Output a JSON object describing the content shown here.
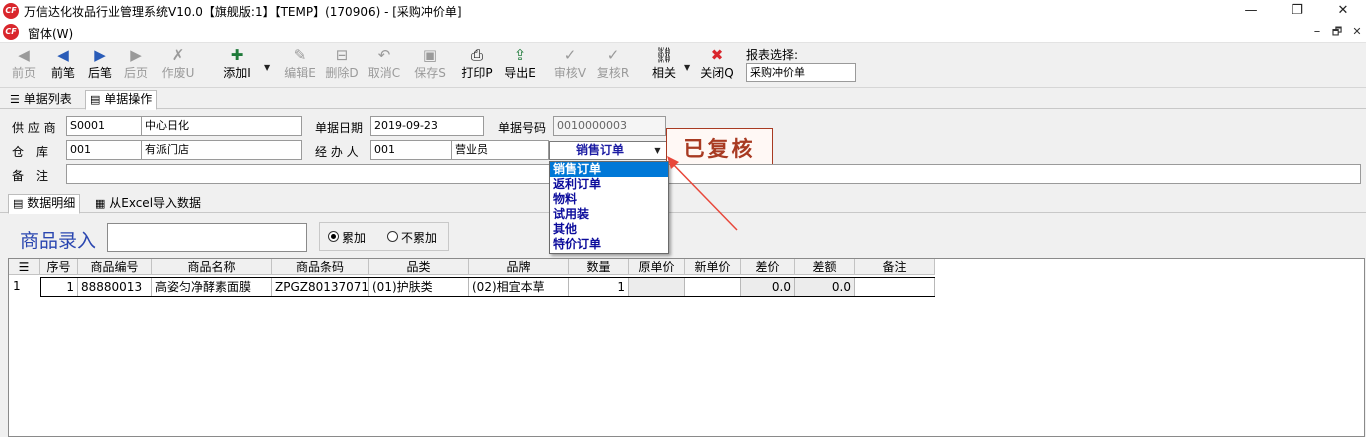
{
  "window": {
    "title": "万信达化妆品行业管理系统V10.0【旗舰版:1】【TEMP】(170906) - [采购冲价单]",
    "menu_label": "窗体(W)",
    "logo_text": "CF",
    "controls": {
      "minimize": "—",
      "maximize": "❐",
      "close": "✕"
    }
  },
  "toolbar": {
    "buttons": [
      {
        "label": "前页",
        "icon": "first-page-icon",
        "glyph": "◀",
        "enabled": false
      },
      {
        "label": "前笔",
        "icon": "prev-record-icon",
        "glyph": "◀",
        "enabled": true
      },
      {
        "label": "后笔",
        "icon": "next-record-icon",
        "glyph": "▶",
        "enabled": true
      },
      {
        "label": "后页",
        "icon": "last-page-icon",
        "glyph": "▶",
        "enabled": false
      },
      {
        "label": "作废U",
        "icon": "void-icon",
        "glyph": "✗",
        "enabled": false
      },
      {
        "label": "添加I",
        "icon": "add-icon",
        "glyph": "✚",
        "enabled": true
      },
      {
        "label": "编辑E",
        "icon": "edit-icon",
        "glyph": "✎",
        "enabled": false
      },
      {
        "label": "删除D",
        "icon": "delete-icon",
        "glyph": "⊟",
        "enabled": false
      },
      {
        "label": "取消C",
        "icon": "undo-icon",
        "glyph": "↶",
        "enabled": false
      },
      {
        "label": "保存S",
        "icon": "save-icon",
        "glyph": "▣",
        "enabled": false
      },
      {
        "label": "打印P",
        "icon": "print-icon",
        "glyph": "⎙",
        "enabled": true
      },
      {
        "label": "导出E",
        "icon": "export-icon",
        "glyph": "⇪",
        "enabled": true
      },
      {
        "label": "审核V",
        "icon": "approve-icon",
        "glyph": "✓",
        "enabled": false
      },
      {
        "label": "复核R",
        "icon": "review-icon",
        "glyph": "✓",
        "enabled": false
      },
      {
        "label": "相关",
        "icon": "link-icon",
        "glyph": "⛓",
        "enabled": true
      },
      {
        "label": "关闭Q",
        "icon": "close-icon",
        "glyph": "✖",
        "enabled": true
      }
    ],
    "report_select_label": "报表选择:",
    "report_select_value": "采购冲价单"
  },
  "tabs_top": [
    {
      "label": "单据列表",
      "icon": "list-icon"
    },
    {
      "label": "单据操作",
      "icon": "document-icon"
    }
  ],
  "form": {
    "supplier_label": "供 应 商",
    "supplier_code": "S0001",
    "supplier_name": "中心日化",
    "doc_date_label": "单据日期",
    "doc_date": "2019-09-23",
    "doc_no_label": "单据号码",
    "doc_no": "0010000003",
    "warehouse_label": "仓　库",
    "warehouse_code": "001",
    "warehouse_name": "有派门店",
    "handler_label": "经 办 人",
    "handler_code": "001",
    "handler_name": "营业员",
    "remark_label": "备　注",
    "remark": "",
    "order_type_selected": "销售订单",
    "order_type_options": [
      "销售订单",
      "返利订单",
      "物料",
      "试用装",
      "其他",
      "特价订单"
    ],
    "status_stamp": "已复核"
  },
  "tabs_detail": [
    {
      "label": "数据明细",
      "icon": "detail-icon"
    },
    {
      "label": "从Excel导入数据",
      "icon": "excel-icon"
    }
  ],
  "entry": {
    "label": "商品录入",
    "value": "",
    "radio_accumulate": "累加",
    "radio_no_accumulate": "不累加",
    "accumulate_selected": true
  },
  "grid": {
    "columns": [
      "序号",
      "商品编号",
      "商品名称",
      "商品条码",
      "品类",
      "品牌",
      "数量",
      "原单价",
      "新单价",
      "差价",
      "差额",
      "备注"
    ],
    "rows": [
      {
        "row_no": "1",
        "seq": "1",
        "code": "88880013",
        "name": "高姿匀净酵素面膜",
        "barcode": "ZPGZ80137071",
        "category": "(01)护肤类",
        "brand": "(02)相宜本草",
        "qty": "1",
        "old_price": "",
        "new_price": "",
        "price_diff": "0.0",
        "amount_diff": "0.0",
        "remark": ""
      }
    ]
  },
  "colors": {
    "accent": "#0078d7",
    "stamp": "#a83a22",
    "arrow": "#e8473a",
    "entry_label": "#2a46b0"
  }
}
